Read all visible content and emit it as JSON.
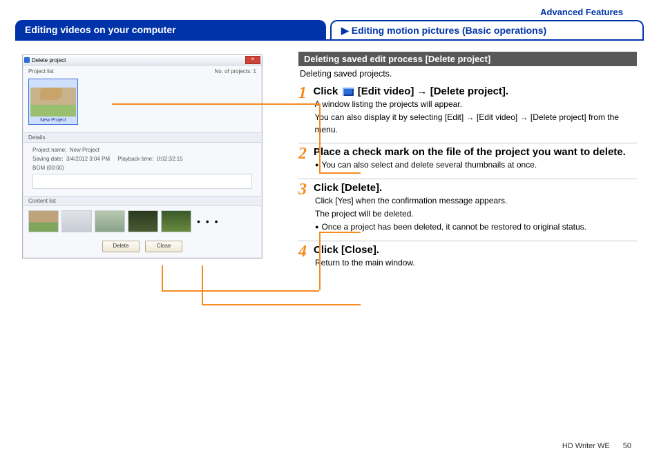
{
  "header": {
    "top_link": "Advanced Features",
    "tab_left": "Editing videos on your computer",
    "tab_right_arrow": "▶",
    "tab_right": "Editing motion pictures (Basic operations)"
  },
  "window": {
    "title": "Delete project",
    "close_glyph": "×",
    "project_list_label": "Project list",
    "no_of_projects_label": "No. of projects:",
    "no_of_projects_value": "1",
    "project_thumb_caption": "New Project",
    "details_label": "Details",
    "details_line1_a": "Project name:",
    "details_line1_b": "New Project",
    "details_line2_a": "Saving date:",
    "details_line2_b": "3/4/2012 3:04 PM",
    "details_line2_c": "Playback time:",
    "details_line2_d": "0:02:32:15",
    "details_line3": "BGM (00:00)",
    "content_list_label": "Content list",
    "dots": "• • •",
    "btn_delete": "Delete",
    "btn_close": "Close"
  },
  "right": {
    "subheading": "Deleting saved edit process [Delete project]",
    "lead": "Deleting saved projects.",
    "steps": {
      "s1": {
        "num": "1",
        "title_a": "Click",
        "title_b": "[Edit video] → [Delete project].",
        "desc_l1": "A window listing the projects will appear.",
        "desc_l2": "You can also display it by selecting [Edit] → [Edit video] → [Delete project] from the menu."
      },
      "s2": {
        "num": "2",
        "title": "Place a check mark on the file of the project you want to delete.",
        "desc_l1": "You can also select and delete several thumbnails at once."
      },
      "s3": {
        "num": "3",
        "title": "Click [Delete].",
        "desc_l1": "Click [Yes] when the confirmation message appears.",
        "desc_l2": "The project will be deleted.",
        "desc_l3": "Once a project has been deleted, it cannot be restored to original status."
      },
      "s4": {
        "num": "4",
        "title": "Click [Close].",
        "desc_l1": "Return to the main window."
      }
    }
  },
  "footer": {
    "product": "HD Writer WE",
    "page": "50"
  }
}
